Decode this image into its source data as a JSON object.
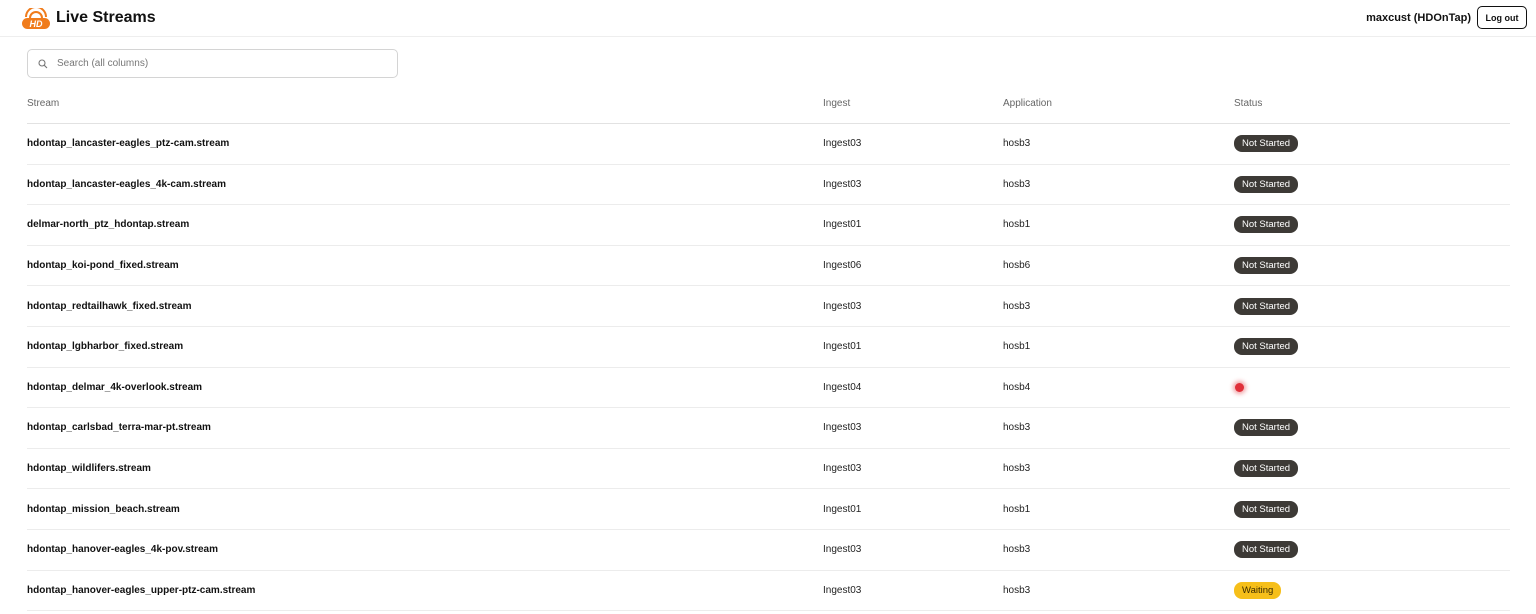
{
  "header": {
    "title": "Live Streams",
    "logo_text": "HD",
    "user": "maxcust (HDOnTap)",
    "logout_label": "Log out"
  },
  "search": {
    "placeholder": "Search (all columns)",
    "value": ""
  },
  "table": {
    "columns": [
      "Stream",
      "Ingest",
      "Application",
      "Status"
    ],
    "rows": [
      {
        "stream": "hdontap_lancaster-eagles_ptz-cam.stream",
        "ingest": "Ingest03",
        "application": "hosb3",
        "status": "Not Started"
      },
      {
        "stream": "hdontap_lancaster-eagles_4k-cam.stream",
        "ingest": "Ingest03",
        "application": "hosb3",
        "status": "Not Started"
      },
      {
        "stream": "delmar-north_ptz_hdontap.stream",
        "ingest": "Ingest01",
        "application": "hosb1",
        "status": "Not Started"
      },
      {
        "stream": "hdontap_koi-pond_fixed.stream",
        "ingest": "Ingest06",
        "application": "hosb6",
        "status": "Not Started"
      },
      {
        "stream": "hdontap_redtailhawk_fixed.stream",
        "ingest": "Ingest03",
        "application": "hosb3",
        "status": "Not Started"
      },
      {
        "stream": "hdontap_lgbharbor_fixed.stream",
        "ingest": "Ingest01",
        "application": "hosb1",
        "status": "Not Started"
      },
      {
        "stream": "hdontap_delmar_4k-overlook.stream",
        "ingest": "Ingest04",
        "application": "hosb4",
        "status": "",
        "status_indicator": "red-dot"
      },
      {
        "stream": "hdontap_carlsbad_terra-mar-pt.stream",
        "ingest": "Ingest03",
        "application": "hosb3",
        "status": "Not Started"
      },
      {
        "stream": "hdontap_wildlifers.stream",
        "ingest": "Ingest03",
        "application": "hosb3",
        "status": "Not Started"
      },
      {
        "stream": "hdontap_mission_beach.stream",
        "ingest": "Ingest01",
        "application": "hosb1",
        "status": "Not Started"
      },
      {
        "stream": "hdontap_hanover-eagles_4k-pov.stream",
        "ingest": "Ingest03",
        "application": "hosb3",
        "status": "Not Started"
      },
      {
        "stream": "hdontap_hanover-eagles_upper-ptz-cam.stream",
        "ingest": "Ingest03",
        "application": "hosb3",
        "status": "Waiting"
      }
    ]
  },
  "colors": {
    "not_started": "#3d3a36",
    "waiting": "#f6bf1a",
    "live_dot": "#e0303a",
    "logo": "#f07c1c"
  }
}
